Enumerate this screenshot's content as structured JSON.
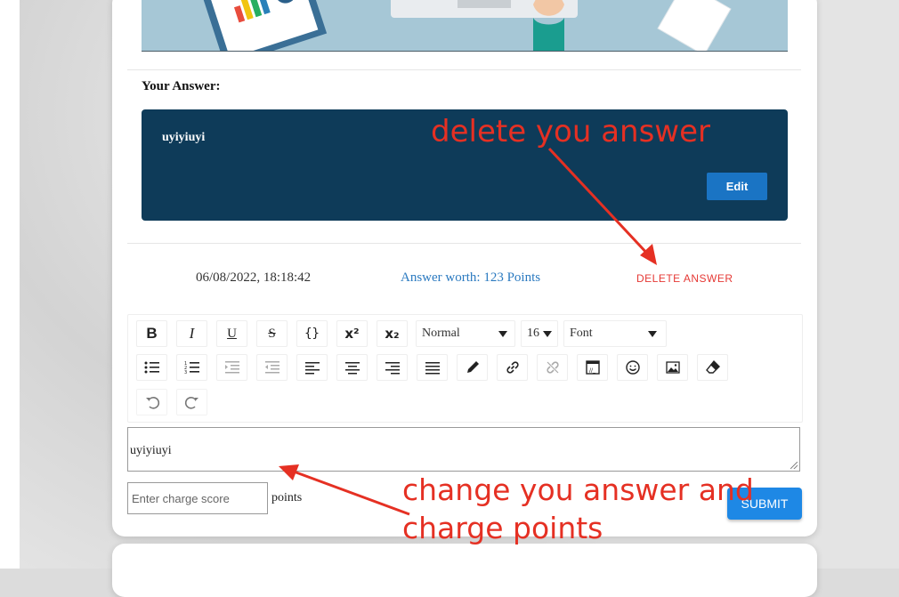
{
  "answer_section": {
    "heading": "Your Answer:",
    "answer_text": "uyiyiuyi",
    "edit_label": "Edit"
  },
  "meta": {
    "date": "06/08/2022, 18:18:42",
    "worth": "Answer worth: 123 Points",
    "delete_label": "DELETE ANSWER"
  },
  "toolbar": {
    "bold": "B",
    "italic": "I",
    "underline": "U",
    "strike": "S",
    "code": "{}",
    "superscript": "x²",
    "subscript": "x₂",
    "block_type": "Normal",
    "font_size": "16",
    "font_family": "Font"
  },
  "editor": {
    "content": "uyiyiuyi"
  },
  "score": {
    "placeholder": "Enter charge score",
    "unit": "points",
    "submit_label": "SUBMIT"
  },
  "annotations": {
    "delete_note": "delete you answer",
    "change_note_line1": "change you answer and",
    "change_note_line2": "charge points"
  },
  "colors": {
    "answer_box": "#0e3b59",
    "accent_blue": "#1e88e5",
    "delete_red": "#e53935",
    "annotation_red": "#e53023"
  }
}
